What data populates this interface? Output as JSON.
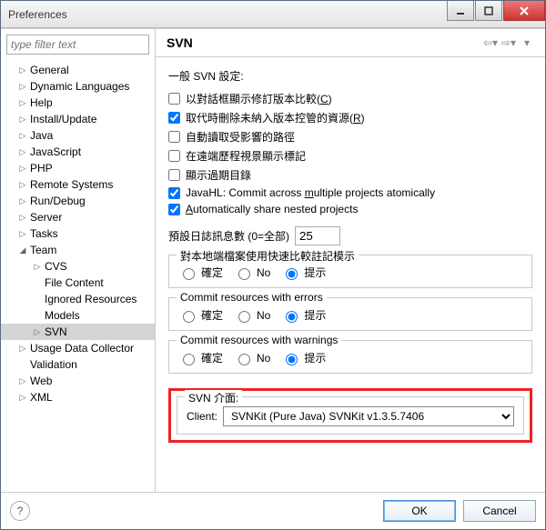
{
  "window": {
    "title": "Preferences"
  },
  "filter": {
    "placeholder": "type filter text"
  },
  "tree": {
    "items": [
      {
        "label": "General",
        "depth": 1,
        "tw": "▷"
      },
      {
        "label": "Dynamic Languages",
        "depth": 1,
        "tw": "▷"
      },
      {
        "label": "Help",
        "depth": 1,
        "tw": "▷"
      },
      {
        "label": "Install/Update",
        "depth": 1,
        "tw": "▷"
      },
      {
        "label": "Java",
        "depth": 1,
        "tw": "▷"
      },
      {
        "label": "JavaScript",
        "depth": 1,
        "tw": "▷"
      },
      {
        "label": "PHP",
        "depth": 1,
        "tw": "▷"
      },
      {
        "label": "Remote Systems",
        "depth": 1,
        "tw": "▷"
      },
      {
        "label": "Run/Debug",
        "depth": 1,
        "tw": "▷"
      },
      {
        "label": "Server",
        "depth": 1,
        "tw": "▷"
      },
      {
        "label": "Tasks",
        "depth": 1,
        "tw": "▷"
      },
      {
        "label": "Team",
        "depth": 1,
        "tw": "◢"
      },
      {
        "label": "CVS",
        "depth": 2,
        "tw": "▷"
      },
      {
        "label": "File Content",
        "depth": 2,
        "tw": ""
      },
      {
        "label": "Ignored Resources",
        "depth": 2,
        "tw": ""
      },
      {
        "label": "Models",
        "depth": 2,
        "tw": ""
      },
      {
        "label": "SVN",
        "depth": 2,
        "tw": "▷",
        "selected": true
      },
      {
        "label": "Usage Data Collector",
        "depth": 1,
        "tw": "▷"
      },
      {
        "label": "Validation",
        "depth": 1,
        "tw": ""
      },
      {
        "label": "Web",
        "depth": 1,
        "tw": "▷"
      },
      {
        "label": "XML",
        "depth": 1,
        "tw": "▷"
      }
    ]
  },
  "page": {
    "title": "SVN",
    "general_label": "一般 SVN 設定:",
    "checks": {
      "show_compare": {
        "label_pre": "以對話框顯示修訂版本比較(",
        "key": "C",
        "label_post": ")",
        "checked": false
      },
      "remove_unversioned": {
        "label_pre": "取代時刪除未納入版本控管的資源(",
        "key": "R",
        "label_post": ")",
        "checked": true
      },
      "auto_read": {
        "label": "自動讀取受影響的路徑",
        "checked": false
      },
      "remote_history": {
        "label": "在遠端歷程視景顯示標記",
        "checked": false
      },
      "show_outdated": {
        "label": "顯示過期目錄",
        "checked": false
      },
      "javahl": {
        "label_pre": "JavaHL: Commit across ",
        "key": "m",
        "mid": "ultiple projects atomically",
        "checked": true
      },
      "auto_share": {
        "label_pre": "",
        "key": "A",
        "mid": "utomatically share nested projects",
        "checked": true
      }
    },
    "log": {
      "label": "預設日誌訊息數 (0=全部)",
      "value": "25"
    },
    "fs_diff": {
      "legend": "對本地端檔案使用快速比較註記模示",
      "ok": "確定",
      "no": "No",
      "prompt": "提示",
      "selected": "prompt"
    },
    "fs_errors": {
      "legend": "Commit resources with errors",
      "ok": "確定",
      "no": "No",
      "prompt": "提示",
      "selected": "prompt"
    },
    "fs_warnings": {
      "legend": "Commit resources with warnings",
      "ok": "確定",
      "no": "No",
      "prompt": "提示",
      "selected": "prompt"
    },
    "svn_iface": {
      "legend": "SVN 介面:",
      "client_label": "Client:",
      "client_value": "SVNKit (Pure Java) SVNKit v1.3.5.7406"
    }
  },
  "footer": {
    "ok": "OK",
    "cancel": "Cancel"
  }
}
